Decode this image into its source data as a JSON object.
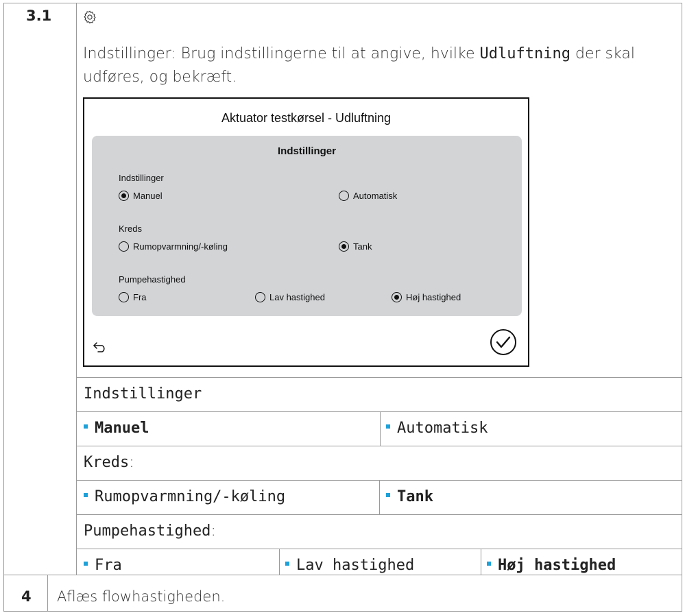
{
  "steps": {
    "first": {
      "number": "3.1",
      "intro_before": "Indstillinger: Brug indstillingerne til at angive, hvilke ",
      "intro_highlight": "Udluftning",
      "intro_after": " der skal udføres, og bekræft."
    },
    "second": {
      "number": "4",
      "text": "Aflæs flowhastigheden."
    }
  },
  "icons": {
    "settings": "gear-icon",
    "back": "back-arrow-icon",
    "confirm": "checkmark-circle-icon"
  },
  "screen": {
    "title": "Aktuator testkørsel  -  Udluftning",
    "panel_title": "Indstillinger",
    "groups": {
      "mode": {
        "label": "Indstillinger",
        "options": [
          "Manuel",
          "Automatisk"
        ],
        "selected": "Manuel"
      },
      "circuit": {
        "label": "Kreds",
        "options": [
          "Rumopvarmning/-køling",
          "Tank"
        ],
        "selected": "Tank"
      },
      "pump": {
        "label": "Pumpehastighed",
        "options": [
          "Fra",
          "Lav hastighed",
          "Høj hastighed"
        ],
        "selected": "Høj hastighed"
      }
    }
  },
  "table": {
    "mode_header": "Indstillinger",
    "mode_options": [
      "Manuel",
      "Automatisk"
    ],
    "circuit_header": "Kreds",
    "circuit_options": [
      "Rumopvarmning/-køling",
      "Tank"
    ],
    "pump_header": "Pumpehastighed",
    "pump_options": [
      "Fra",
      "Lav hastighed",
      "Høj hastighed"
    ],
    "colon": ":"
  },
  "colors": {
    "bullet": "#1ea1d8",
    "panel": "#d2d4d6",
    "border": "#9a9a9a"
  }
}
